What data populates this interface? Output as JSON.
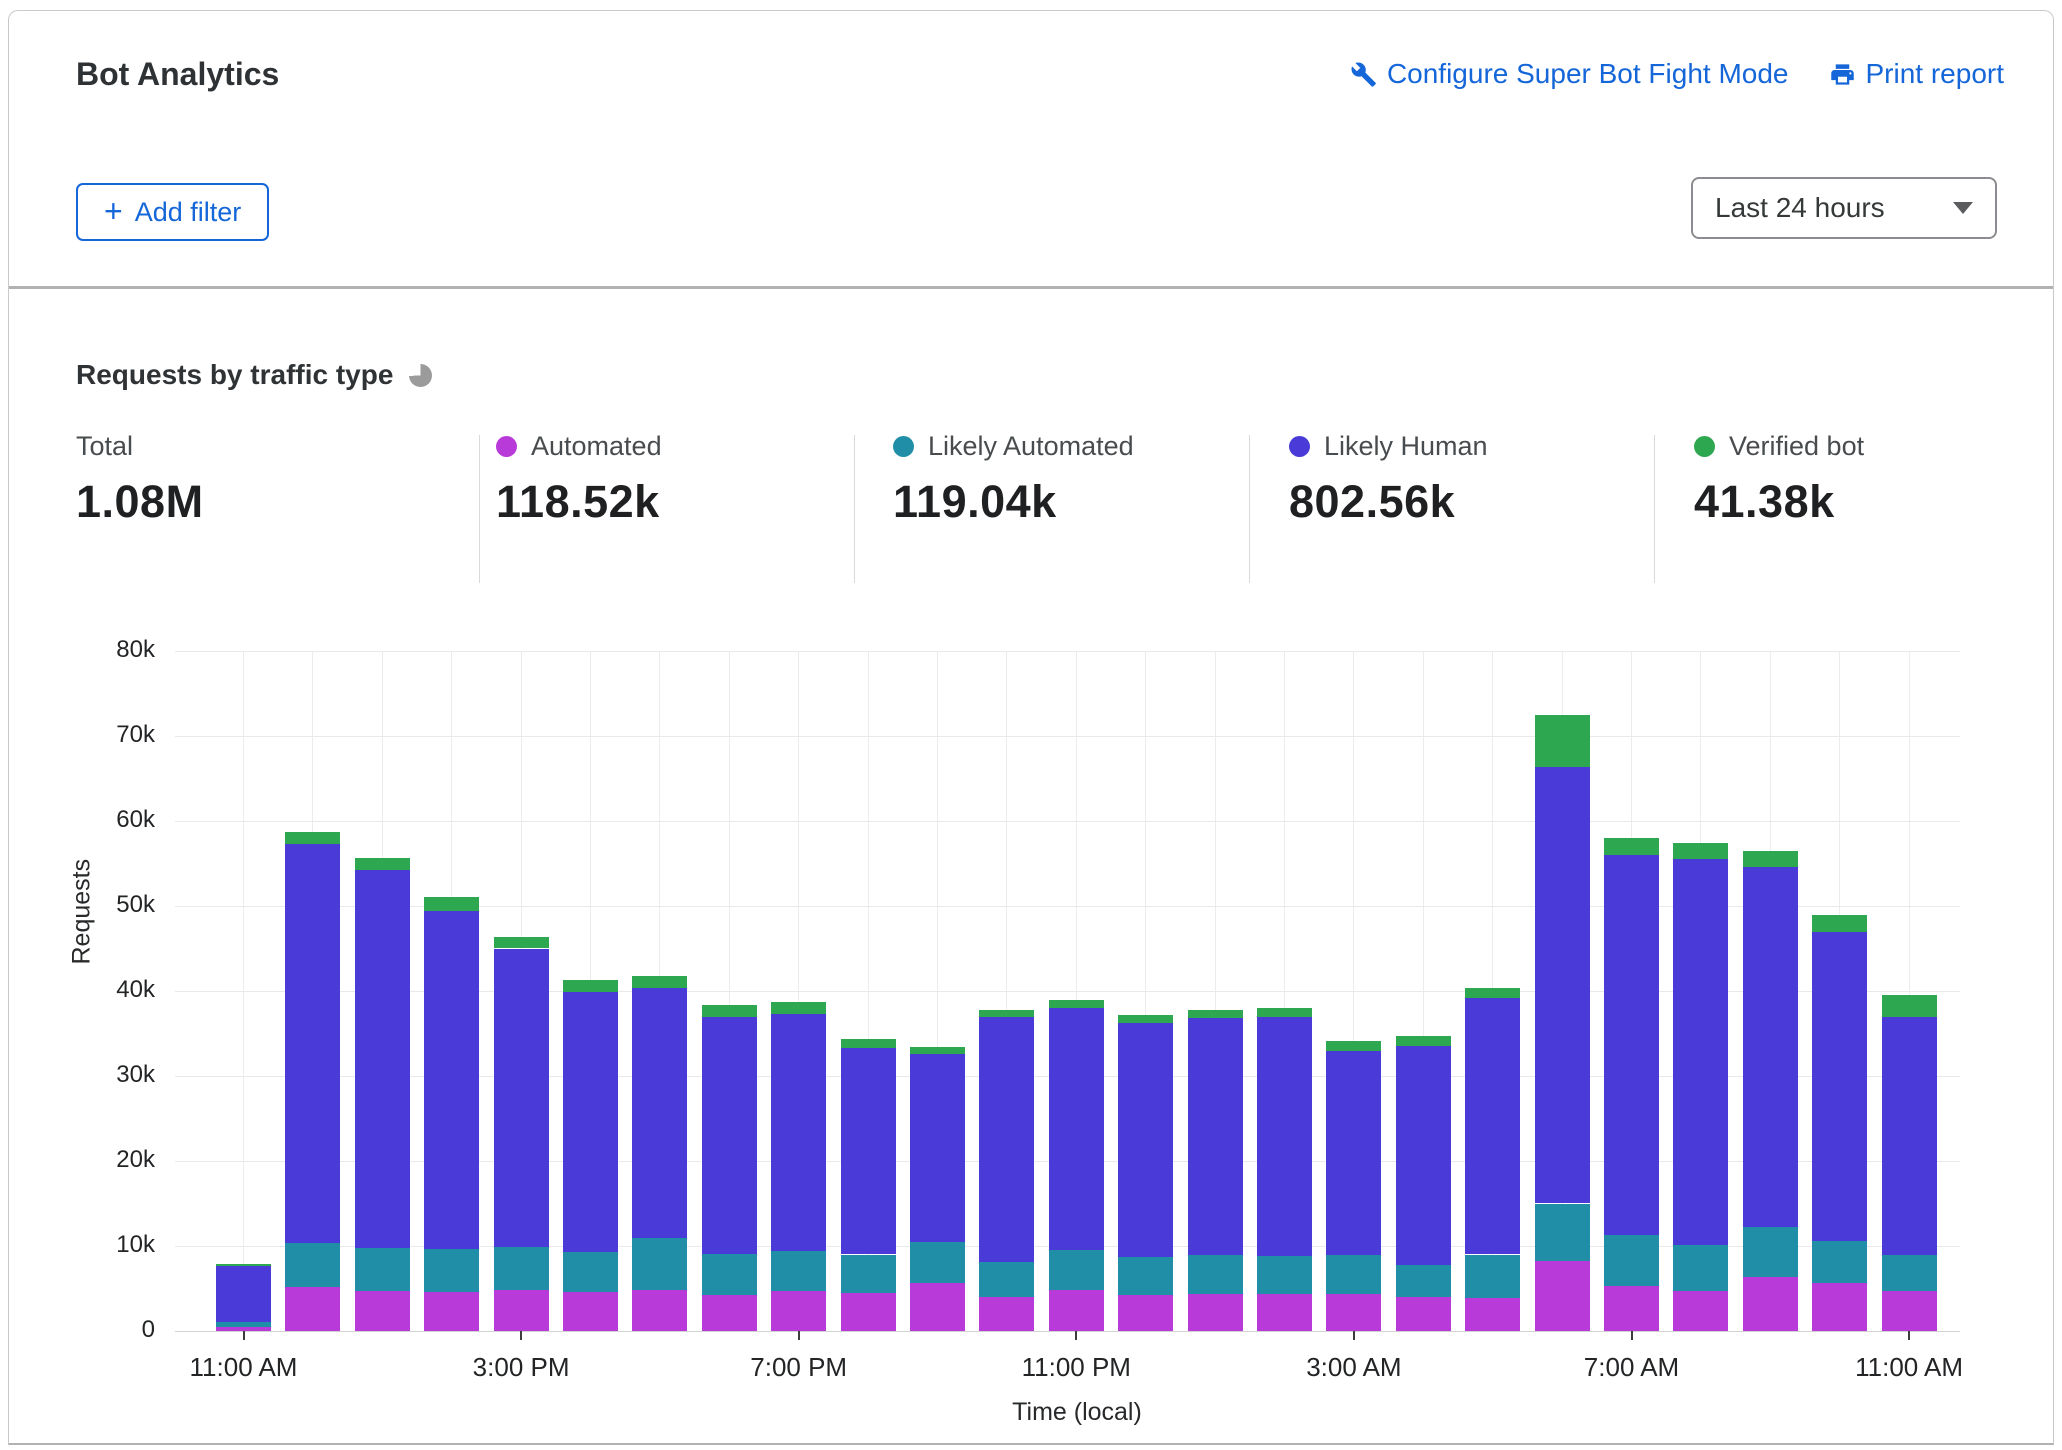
{
  "header": {
    "title": "Bot Analytics",
    "configure_link": "Configure Super Bot Fight Mode",
    "print_link": "Print report",
    "add_filter_label": "Add filter",
    "time_range_selected": "Last 24 hours"
  },
  "section": {
    "title": "Requests by traffic type"
  },
  "stats": [
    {
      "label": "Total",
      "value": "1.08M",
      "color": ""
    },
    {
      "label": "Automated",
      "value": "118.52k",
      "color": "#b83bd9"
    },
    {
      "label": "Likely Automated",
      "value": "119.04k",
      "color": "#1f8ea6"
    },
    {
      "label": "Likely Human",
      "value": "802.56k",
      "color": "#4a3ad8"
    },
    {
      "label": "Verified bot",
      "value": "41.38k",
      "color": "#2ea850"
    }
  ],
  "chart_data": {
    "type": "bar",
    "stacked": true,
    "title": "Requests by traffic type",
    "xlabel": "Time (local)",
    "ylabel": "Requests",
    "ylim_requests": [
      0,
      80000
    ],
    "values_unit": "thousands of requests per hour",
    "grid": true,
    "y_tick_labels": [
      "0",
      "10k",
      "20k",
      "30k",
      "40k",
      "50k",
      "60k",
      "70k",
      "80k"
    ],
    "x": [
      "11 AM",
      "12 PM",
      "1 PM",
      "2 PM",
      "3 PM",
      "4 PM",
      "5 PM",
      "6 PM",
      "7 PM",
      "8 PM",
      "9 PM",
      "10 PM",
      "11 PM",
      "12 AM",
      "1 AM",
      "2 AM",
      "3 AM",
      "4 AM",
      "5 AM",
      "6 AM",
      "7 AM",
      "8 AM",
      "9 AM",
      "10 AM",
      "11 AM"
    ],
    "x_tick_labels": [
      "11:00 AM",
      "3:00 PM",
      "7:00 PM",
      "11:00 PM",
      "3:00 AM",
      "7:00 AM",
      "11:00 AM"
    ],
    "x_tick_indices": [
      0,
      4,
      8,
      12,
      16,
      20,
      24
    ],
    "series": [
      {
        "name": "Automated",
        "color": "#b83bd9",
        "values": [
          0.5,
          5.2,
          4.7,
          4.6,
          4.8,
          4.6,
          4.8,
          4.2,
          4.7,
          4.5,
          5.6,
          4.0,
          4.8,
          4.2,
          4.3,
          4.4,
          4.3,
          4.0,
          3.9,
          8.2,
          5.3,
          4.7,
          6.4,
          5.6,
          4.7
        ]
      },
      {
        "name": "Likely Automated",
        "color": "#1f8ea6",
        "values": [
          0.6,
          5.1,
          5.1,
          5.0,
          5.1,
          4.7,
          6.1,
          4.9,
          4.7,
          4.5,
          4.9,
          4.1,
          4.7,
          4.5,
          4.6,
          4.4,
          4.6,
          3.8,
          5.1,
          6.8,
          6.0,
          5.4,
          5.8,
          5.0,
          4.2
        ]
      },
      {
        "name": "Likely Human",
        "color": "#4a3ad8",
        "values": [
          6.6,
          47.0,
          44.4,
          39.8,
          35.1,
          30.6,
          29.4,
          27.8,
          27.9,
          24.3,
          22.1,
          28.8,
          28.5,
          27.5,
          27.9,
          28.2,
          24.0,
          25.7,
          30.2,
          51.3,
          44.7,
          45.4,
          42.4,
          36.4,
          28.1
        ]
      },
      {
        "name": "Verified bot",
        "color": "#2ea850",
        "values": [
          0.2,
          1.4,
          1.5,
          1.7,
          1.4,
          1.4,
          1.5,
          1.5,
          1.4,
          1.1,
          0.8,
          0.9,
          0.9,
          1.0,
          1.0,
          1.0,
          1.2,
          1.2,
          1.2,
          6.2,
          2.0,
          1.9,
          1.9,
          2.0,
          2.5
        ]
      }
    ]
  }
}
